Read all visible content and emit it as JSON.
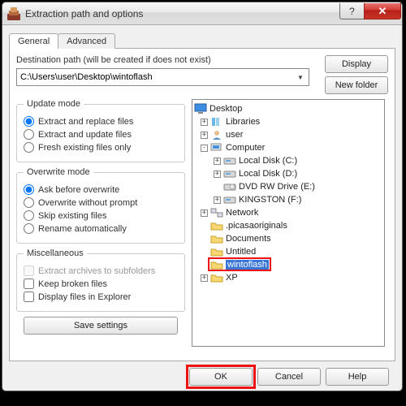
{
  "window": {
    "title": "Extraction path and options"
  },
  "tabs": {
    "general": "General",
    "advanced": "Advanced"
  },
  "dest": {
    "label": "Destination path (will be created if does not exist)",
    "value": "C:\\Users\\user\\Desktop\\wintoflash"
  },
  "buttons": {
    "display": "Display",
    "newfolder": "New folder",
    "save": "Save settings",
    "ok": "OK",
    "cancel": "Cancel",
    "help": "Help"
  },
  "groups": {
    "update": {
      "legend": "Update mode",
      "o1": "Extract and replace files",
      "o2": "Extract and update files",
      "o3": "Fresh existing files only"
    },
    "overwrite": {
      "legend": "Overwrite mode",
      "o1": "Ask before overwrite",
      "o2": "Overwrite without prompt",
      "o3": "Skip existing files",
      "o4": "Rename automatically"
    },
    "misc": {
      "legend": "Miscellaneous",
      "o1": "Extract archives to subfolders",
      "o2": "Keep broken files",
      "o3": "Display files in Explorer"
    }
  },
  "tree": {
    "desktop": "Desktop",
    "libraries": "Libraries",
    "user": "user",
    "computer": "Computer",
    "ldc": "Local Disk (C:)",
    "ldd": "Local Disk (D:)",
    "dvd": "DVD RW Drive (E:)",
    "king": "KINGSTON (F:)",
    "network": "Network",
    "picasa": ".picasaoriginals",
    "docs": "Documents",
    "untitled": "Untitled",
    "wtf": "wintoflash",
    "xp": "XP"
  }
}
